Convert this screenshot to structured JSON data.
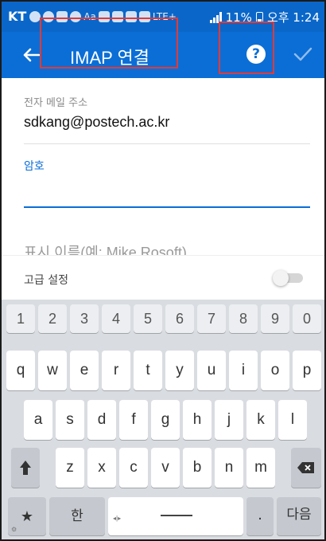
{
  "status_bar": {
    "carrier": "KT",
    "mid_text": "Aa",
    "network": "LTE+",
    "battery": "11%",
    "time": "오후 1:24"
  },
  "app_bar": {
    "title": "IMAP 연결",
    "help_label": "?"
  },
  "form": {
    "email_label": "전자 메일 주소",
    "email_value": "sdkang@postech.ac.kr",
    "password_label": "암호",
    "display_name_placeholder": "표시 이름(예: Mike Rosoft)"
  },
  "advanced": {
    "label": "고급 설정",
    "enabled": false
  },
  "keyboard": {
    "number_row": [
      "1",
      "2",
      "3",
      "4",
      "5",
      "6",
      "7",
      "8",
      "9",
      "0"
    ],
    "row1": [
      "q",
      "w",
      "e",
      "r",
      "t",
      "y",
      "u",
      "i",
      "o",
      "p"
    ],
    "row2": [
      "a",
      "s",
      "d",
      "f",
      "g",
      "h",
      "j",
      "k",
      "l"
    ],
    "row3": [
      "z",
      "x",
      "c",
      "v",
      "b",
      "n",
      "m"
    ],
    "lang_key": "한",
    "period_key": ".",
    "period_hint": "...",
    "next_key": "다음",
    "space_hint": "◂|▸"
  },
  "colors": {
    "status_bar": "#0a67c9",
    "app_bar": "#0b6ed6",
    "accent": "#0b6ed6",
    "highlight_box": "#e53935"
  }
}
